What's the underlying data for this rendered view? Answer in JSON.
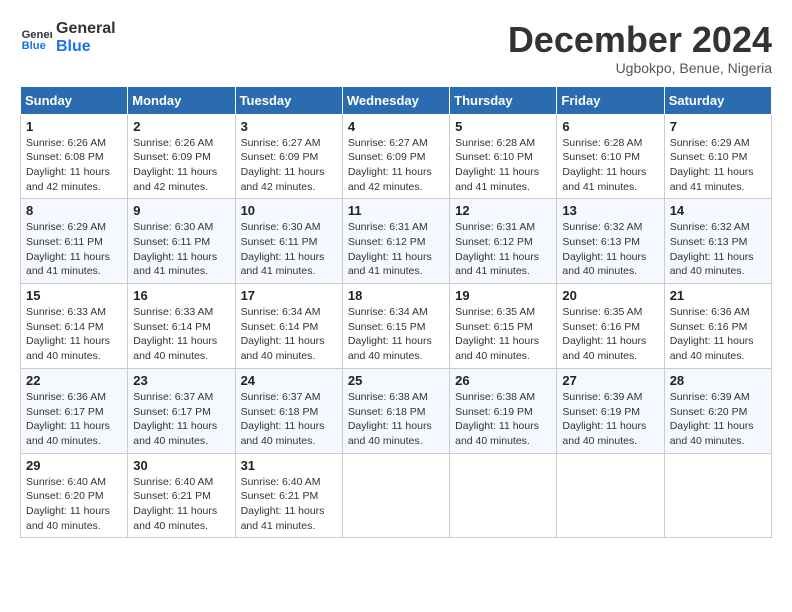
{
  "header": {
    "logo_line1": "General",
    "logo_line2": "Blue",
    "month": "December 2024",
    "location": "Ugbokpo, Benue, Nigeria"
  },
  "days_of_week": [
    "Sunday",
    "Monday",
    "Tuesday",
    "Wednesday",
    "Thursday",
    "Friday",
    "Saturday"
  ],
  "weeks": [
    [
      {
        "day": "1",
        "info": "Sunrise: 6:26 AM\nSunset: 6:08 PM\nDaylight: 11 hours\nand 42 minutes."
      },
      {
        "day": "2",
        "info": "Sunrise: 6:26 AM\nSunset: 6:09 PM\nDaylight: 11 hours\nand 42 minutes."
      },
      {
        "day": "3",
        "info": "Sunrise: 6:27 AM\nSunset: 6:09 PM\nDaylight: 11 hours\nand 42 minutes."
      },
      {
        "day": "4",
        "info": "Sunrise: 6:27 AM\nSunset: 6:09 PM\nDaylight: 11 hours\nand 42 minutes."
      },
      {
        "day": "5",
        "info": "Sunrise: 6:28 AM\nSunset: 6:10 PM\nDaylight: 11 hours\nand 41 minutes."
      },
      {
        "day": "6",
        "info": "Sunrise: 6:28 AM\nSunset: 6:10 PM\nDaylight: 11 hours\nand 41 minutes."
      },
      {
        "day": "7",
        "info": "Sunrise: 6:29 AM\nSunset: 6:10 PM\nDaylight: 11 hours\nand 41 minutes."
      }
    ],
    [
      {
        "day": "8",
        "info": "Sunrise: 6:29 AM\nSunset: 6:11 PM\nDaylight: 11 hours\nand 41 minutes."
      },
      {
        "day": "9",
        "info": "Sunrise: 6:30 AM\nSunset: 6:11 PM\nDaylight: 11 hours\nand 41 minutes."
      },
      {
        "day": "10",
        "info": "Sunrise: 6:30 AM\nSunset: 6:11 PM\nDaylight: 11 hours\nand 41 minutes."
      },
      {
        "day": "11",
        "info": "Sunrise: 6:31 AM\nSunset: 6:12 PM\nDaylight: 11 hours\nand 41 minutes."
      },
      {
        "day": "12",
        "info": "Sunrise: 6:31 AM\nSunset: 6:12 PM\nDaylight: 11 hours\nand 41 minutes."
      },
      {
        "day": "13",
        "info": "Sunrise: 6:32 AM\nSunset: 6:13 PM\nDaylight: 11 hours\nand 40 minutes."
      },
      {
        "day": "14",
        "info": "Sunrise: 6:32 AM\nSunset: 6:13 PM\nDaylight: 11 hours\nand 40 minutes."
      }
    ],
    [
      {
        "day": "15",
        "info": "Sunrise: 6:33 AM\nSunset: 6:14 PM\nDaylight: 11 hours\nand 40 minutes."
      },
      {
        "day": "16",
        "info": "Sunrise: 6:33 AM\nSunset: 6:14 PM\nDaylight: 11 hours\nand 40 minutes."
      },
      {
        "day": "17",
        "info": "Sunrise: 6:34 AM\nSunset: 6:14 PM\nDaylight: 11 hours\nand 40 minutes."
      },
      {
        "day": "18",
        "info": "Sunrise: 6:34 AM\nSunset: 6:15 PM\nDaylight: 11 hours\nand 40 minutes."
      },
      {
        "day": "19",
        "info": "Sunrise: 6:35 AM\nSunset: 6:15 PM\nDaylight: 11 hours\nand 40 minutes."
      },
      {
        "day": "20",
        "info": "Sunrise: 6:35 AM\nSunset: 6:16 PM\nDaylight: 11 hours\nand 40 minutes."
      },
      {
        "day": "21",
        "info": "Sunrise: 6:36 AM\nSunset: 6:16 PM\nDaylight: 11 hours\nand 40 minutes."
      }
    ],
    [
      {
        "day": "22",
        "info": "Sunrise: 6:36 AM\nSunset: 6:17 PM\nDaylight: 11 hours\nand 40 minutes."
      },
      {
        "day": "23",
        "info": "Sunrise: 6:37 AM\nSunset: 6:17 PM\nDaylight: 11 hours\nand 40 minutes."
      },
      {
        "day": "24",
        "info": "Sunrise: 6:37 AM\nSunset: 6:18 PM\nDaylight: 11 hours\nand 40 minutes."
      },
      {
        "day": "25",
        "info": "Sunrise: 6:38 AM\nSunset: 6:18 PM\nDaylight: 11 hours\nand 40 minutes."
      },
      {
        "day": "26",
        "info": "Sunrise: 6:38 AM\nSunset: 6:19 PM\nDaylight: 11 hours\nand 40 minutes."
      },
      {
        "day": "27",
        "info": "Sunrise: 6:39 AM\nSunset: 6:19 PM\nDaylight: 11 hours\nand 40 minutes."
      },
      {
        "day": "28",
        "info": "Sunrise: 6:39 AM\nSunset: 6:20 PM\nDaylight: 11 hours\nand 40 minutes."
      }
    ],
    [
      {
        "day": "29",
        "info": "Sunrise: 6:40 AM\nSunset: 6:20 PM\nDaylight: 11 hours\nand 40 minutes."
      },
      {
        "day": "30",
        "info": "Sunrise: 6:40 AM\nSunset: 6:21 PM\nDaylight: 11 hours\nand 40 minutes."
      },
      {
        "day": "31",
        "info": "Sunrise: 6:40 AM\nSunset: 6:21 PM\nDaylight: 11 hours\nand 41 minutes."
      },
      {
        "day": "",
        "info": ""
      },
      {
        "day": "",
        "info": ""
      },
      {
        "day": "",
        "info": ""
      },
      {
        "day": "",
        "info": ""
      }
    ]
  ]
}
